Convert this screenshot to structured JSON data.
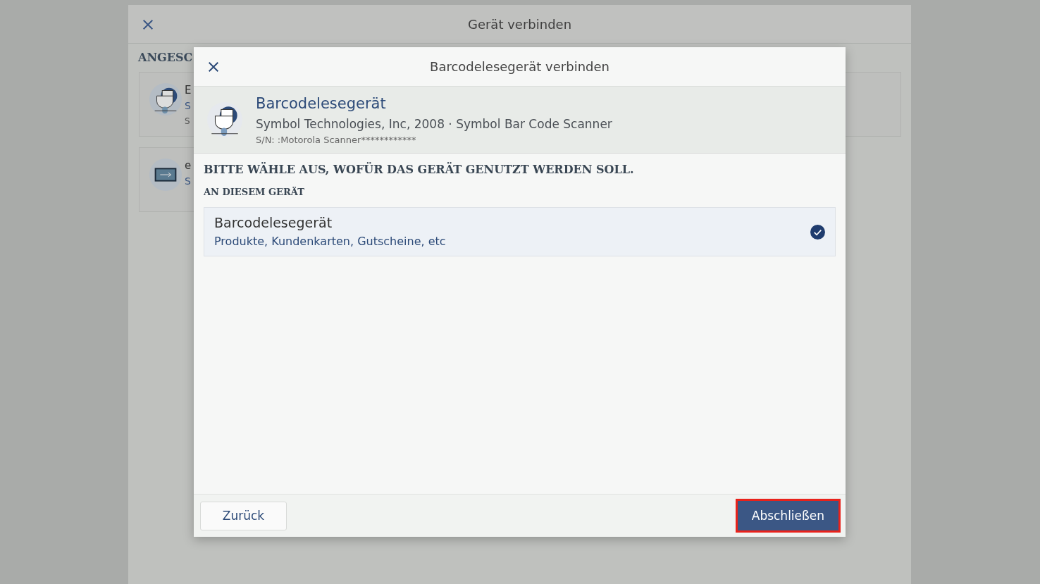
{
  "background_dialog": {
    "title": "Gerät verbinden",
    "section_heading": "ANGESC",
    "devices": [
      {
        "kind": "scanner",
        "name": "E",
        "line_1": "S",
        "line_2": "S"
      },
      {
        "kind": "usb",
        "name": "e",
        "line_1": "S"
      }
    ]
  },
  "dialog": {
    "title": "Barcodelesegerät verbinden",
    "device": {
      "name": "Barcodelesegerät",
      "description": "Symbol Technologies, Inc, 2008 · Symbol Bar Code Scanner",
      "serial": "S/N: :Motorola Scanner************"
    },
    "question": "BITTE WÄHLE AUS, WOFÜR DAS GERÄT GENUTZT WERDEN SOLL.",
    "group_heading": "AN DIESEM GERÄT",
    "options": [
      {
        "label": "Barcodelesegerät",
        "description": "Produkte, Kundenkarten, Gutscheine, etc",
        "selected": true
      }
    ],
    "back_button": "Zurück",
    "finish_button": {
      "label": "Abschließen",
      "highlighted": true
    }
  }
}
